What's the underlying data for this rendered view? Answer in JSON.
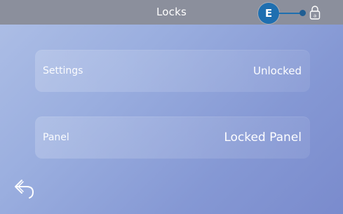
{
  "header": {
    "title": "Locks",
    "callout_label": "E",
    "lock_icon": "padlock-icon"
  },
  "rows": [
    {
      "label": "Settings",
      "value": "Unlocked"
    },
    {
      "label": "Panel",
      "value": "Locked Panel"
    }
  ],
  "footer": {
    "back_icon": "back-arrow-icon"
  },
  "colors": {
    "header_bar": "#8b8f9c",
    "callout": "#1f6fb0",
    "background_start": "#aebfe6",
    "background_end": "#7a8bcd",
    "text": "#ffffff"
  }
}
